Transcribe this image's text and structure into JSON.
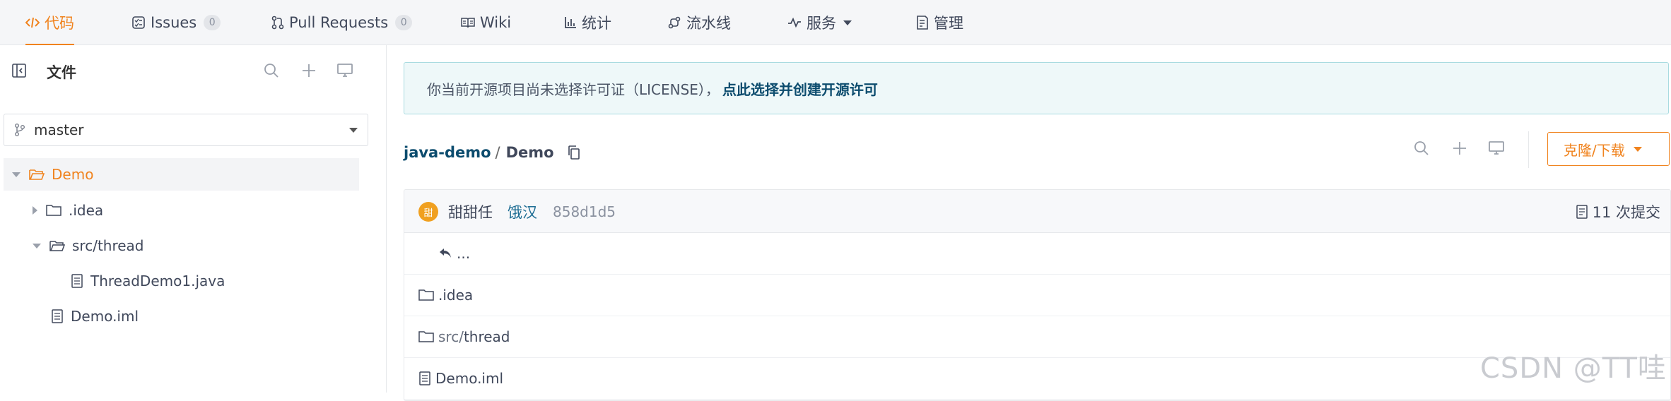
{
  "nav": {
    "tabs": [
      {
        "label": "代码",
        "active": true,
        "icon": "code-icon"
      },
      {
        "label": "Issues",
        "count": "0",
        "icon": "issues-icon"
      },
      {
        "label": "Pull Requests",
        "count": "0",
        "icon": "pull-request-icon"
      },
      {
        "label": "Wiki",
        "icon": "book-icon"
      },
      {
        "label": "统计",
        "icon": "bar-chart-icon"
      },
      {
        "label": "流水线",
        "icon": "pipeline-icon"
      },
      {
        "label": "服务",
        "icon": "pulse-icon",
        "dropdown": true
      },
      {
        "label": "管理",
        "icon": "settings-doc-icon"
      }
    ]
  },
  "sidebar": {
    "title": "文件",
    "branch": "master",
    "tree": [
      {
        "label": "Demo",
        "type": "folder",
        "expanded": true,
        "selected": true
      },
      {
        "label": ".idea",
        "type": "folder",
        "expanded": false
      },
      {
        "label": "src/thread",
        "type": "folder",
        "expanded": true
      },
      {
        "label": "ThreadDemo1.java",
        "type": "file"
      },
      {
        "label": "Demo.iml",
        "type": "file"
      }
    ]
  },
  "notice": {
    "text": "你当前开源项目尚未选择许可证（LICENSE），",
    "link": "点此选择并创建开源许可"
  },
  "breadcrumb": {
    "repo": "java-demo",
    "separator": "/",
    "current": "Demo"
  },
  "toolbar": {
    "clone_label": "克隆/下载"
  },
  "commit": {
    "avatar_text": "甜",
    "author": "甜甜任",
    "message": "饿汉",
    "sha": "858d1d5",
    "count_label": "11 次提交"
  },
  "files": {
    "parent": "...",
    "rows": [
      {
        "prefix": "",
        "name": ".idea",
        "type": "folder"
      },
      {
        "prefix": "src/",
        "name": "thread",
        "type": "folder"
      },
      {
        "prefix": "",
        "name": "Demo.iml",
        "type": "file"
      }
    ]
  },
  "watermark": "CSDN @TT哇",
  "colors": {
    "accent": "#f0831e",
    "link": "#0c4c6e",
    "notice_bg": "#eef8f9",
    "notice_border": "#a9dbe0"
  }
}
